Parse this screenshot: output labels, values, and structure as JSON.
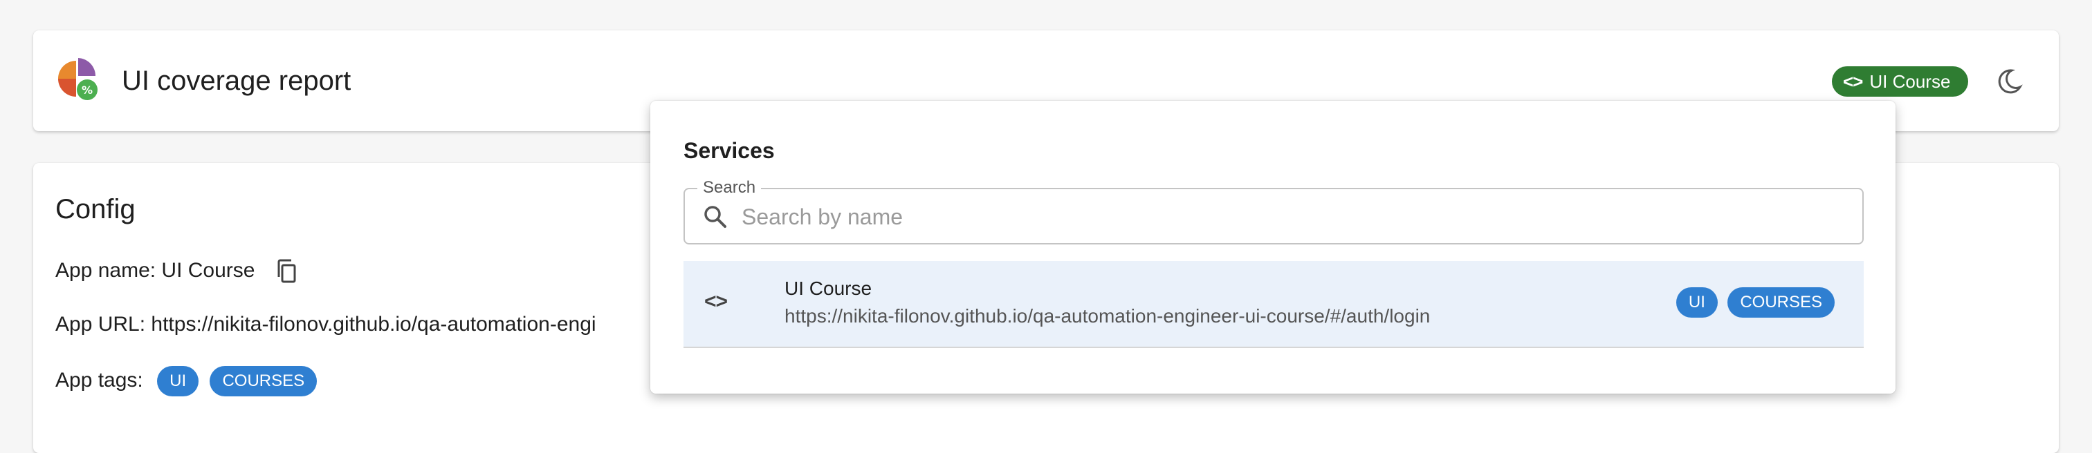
{
  "header": {
    "title": "UI coverage report",
    "logo_icon": "pie-chart-percent-icon",
    "service_chip": {
      "icon": "code-icon",
      "label": "UI Course",
      "color": "#2f7d32"
    },
    "theme_toggle_icon": "moon-icon"
  },
  "config": {
    "title": "Config",
    "app_name_label": "App name: UI Course",
    "copy_icon": "copy-icon",
    "app_url_label": "App URL: https://nikita-filonov.github.io/qa-automation-engi",
    "app_tags_label": "App tags:",
    "tags": [
      "UI",
      "COURSES"
    ],
    "tag_color": "#2f7fd1"
  },
  "services_popover": {
    "title": "Services",
    "search": {
      "legend": "Search",
      "placeholder": "Search by name",
      "value": ""
    },
    "results": [
      {
        "icon": "code-icon",
        "name": "UI Course",
        "url": "https://nikita-filonov.github.io/qa-automation-engineer-ui-course/#/auth/login",
        "tags": [
          "UI",
          "COURSES"
        ]
      }
    ]
  }
}
